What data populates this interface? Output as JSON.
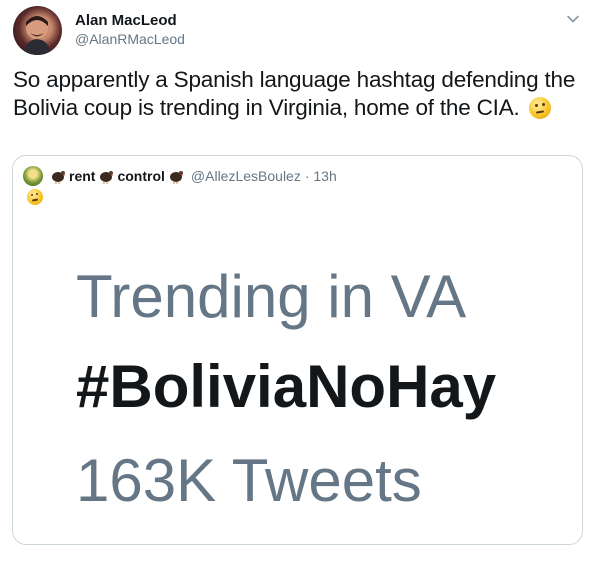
{
  "tweet": {
    "author_name": "Alan MacLeod",
    "author_handle": "@AlanRMacLeod",
    "text": "So apparently a Spanish language hashtag defending the Bolivia coup is trending in Virginia, home of the CIA.",
    "emoji": "thinking-face-emoji"
  },
  "quoted": {
    "name_part1": "rent",
    "name_part2": "control",
    "handle": "@AllezLesBoulez",
    "time": "· 13h",
    "icons": [
      "avatar",
      "turkey-icon",
      "turkey-icon",
      "turkey-icon",
      "thinking-face-emoji"
    ],
    "image": {
      "line1": "Trending in VA",
      "line2": "#BoliviaNoHay",
      "line3": "163K Tweets"
    }
  },
  "colors": {
    "text_primary": "#14171a",
    "text_secondary": "#657786",
    "border": "#ccd6dd"
  }
}
